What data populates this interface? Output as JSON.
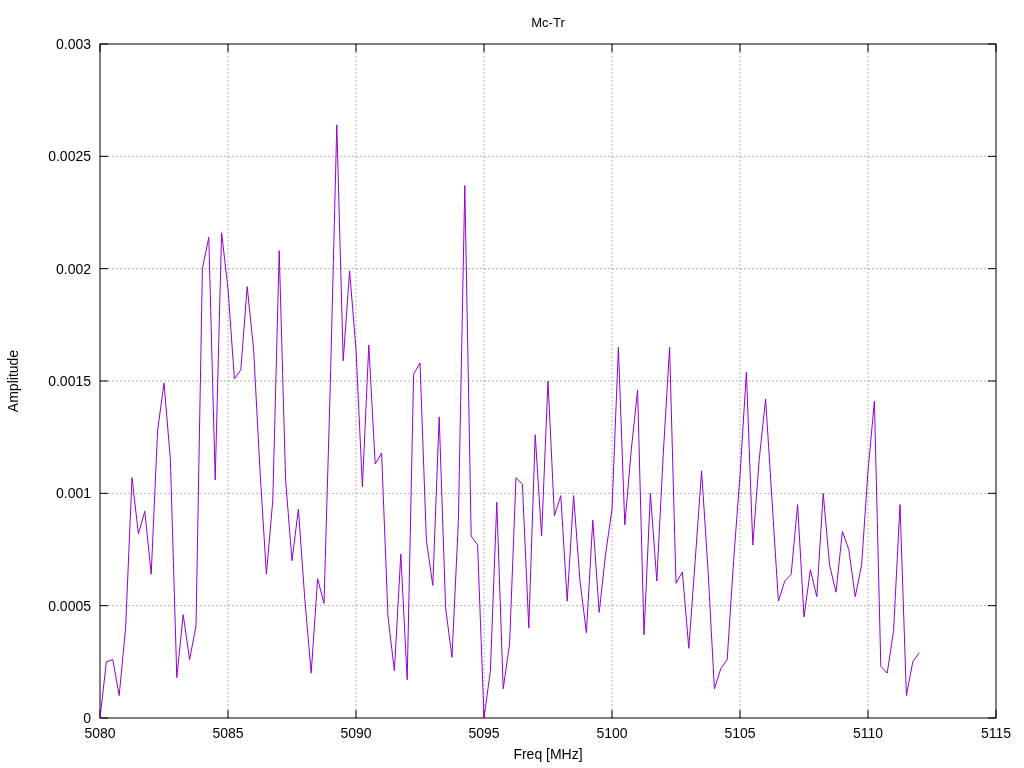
{
  "chart_data": {
    "type": "line",
    "title": "Mc-Tr",
    "xlabel": "Freq [MHz]",
    "ylabel": "Amplitude",
    "xlim": [
      5080,
      5115
    ],
    "grid": true,
    "ylim": [
      0,
      0.003
    ],
    "xticks": [
      5080,
      5085,
      5090,
      5095,
      5100,
      5105,
      5110,
      5115
    ],
    "yticks": [
      0,
      0.0005,
      0.001,
      0.0015,
      0.002,
      0.0025,
      0.003
    ],
    "x": [
      5080,
      5080.25,
      5080.5,
      5080.75,
      5081,
      5081.25,
      5081.5,
      5081.75,
      5082,
      5082.25,
      5082.5,
      5082.75,
      5083,
      5083.25,
      5083.5,
      5083.75,
      5084,
      5084.25,
      5084.5,
      5084.75,
      5085,
      5085.25,
      5085.5,
      5085.75,
      5086,
      5086.25,
      5086.5,
      5086.75,
      5087,
      5087.25,
      5087.5,
      5087.75,
      5088,
      5088.25,
      5088.5,
      5088.75,
      5089,
      5089.25,
      5089.5,
      5089.75,
      5090,
      5090.25,
      5090.5,
      5090.75,
      5091,
      5091.25,
      5091.5,
      5091.75,
      5092,
      5092.25,
      5092.5,
      5092.75,
      5093,
      5093.25,
      5093.5,
      5093.75,
      5094,
      5094.25,
      5094.5,
      5094.75,
      5095,
      5095.25,
      5095.5,
      5095.75,
      5096,
      5096.25,
      5096.5,
      5096.75,
      5097,
      5097.25,
      5097.5,
      5097.75,
      5098,
      5098.25,
      5098.5,
      5098.75,
      5099,
      5099.25,
      5099.5,
      5099.75,
      5100,
      5100.25,
      5100.5,
      5100.75,
      5101,
      5101.25,
      5101.5,
      5101.75,
      5102,
      5102.25,
      5102.5,
      5102.75,
      5103,
      5103.25,
      5103.5,
      5103.75,
      5104,
      5104.25,
      5104.5,
      5104.75,
      5105,
      5105.25,
      5105.5,
      5105.75,
      5106,
      5106.25,
      5106.5,
      5106.75,
      5107,
      5107.25,
      5107.5,
      5107.75,
      5108,
      5108.25,
      5108.5,
      5108.75,
      5109,
      5109.25,
      5109.5,
      5109.75,
      5110,
      5110.25,
      5110.5,
      5110.75,
      5111,
      5111.25,
      5111.5,
      5111.75,
      5112
    ],
    "series": [
      {
        "color": "#9400d3",
        "values": [
          0,
          0.00025,
          0.00026,
          0.0001,
          0.0004,
          0.00107,
          0.00082,
          0.00092,
          0.00064,
          0.00128,
          0.00149,
          0.00115,
          0.00018,
          0.00046,
          0.00026,
          0.00041,
          0.002,
          0.00214,
          0.00106,
          0.00216,
          0.00191,
          0.00151,
          0.00155,
          0.00192,
          0.00164,
          0.0011,
          0.00064,
          0.00097,
          0.00208,
          0.00106,
          0.0007,
          0.00093,
          0.00053,
          0.0002,
          0.00062,
          0.00051,
          0.0015,
          0.00264,
          0.00159,
          0.00199,
          0.00164,
          0.00103,
          0.00166,
          0.00113,
          0.00118,
          0.00045,
          0.00021,
          0.00073,
          0.00017,
          0.00153,
          0.00158,
          0.00079,
          0.00059,
          0.00134,
          0.00049,
          0.00027,
          0.00088,
          0.00237,
          0.00081,
          0.00077,
          0,
          0.00021,
          0.00096,
          0.00013,
          0.00033,
          0.00107,
          0.00104,
          0.0004,
          0.00126,
          0.00081,
          0.0015,
          0.0009,
          0.00099,
          0.00052,
          0.00099,
          0.00061,
          0.00038,
          0.00088,
          0.00047,
          0.00073,
          0.00093,
          0.00165,
          0.00086,
          0.00119,
          0.00146,
          0.00037,
          0.001,
          0.00061,
          0.00117,
          0.00165,
          0.0006,
          0.00065,
          0.00031,
          0.0007,
          0.0011,
          0.00066,
          0.00013,
          0.00022,
          0.00026,
          0.0007,
          0.00108,
          0.00154,
          0.00077,
          0.00115,
          0.00142,
          0.00097,
          0.00052,
          0.00061,
          0.00064,
          0.00095,
          0.00045,
          0.00066,
          0.00054,
          0.001,
          0.00068,
          0.00056,
          0.00083,
          0.00075,
          0.00054,
          0.00068,
          0.0011,
          0.00141,
          0.00023,
          0.0002,
          0.00039,
          0.00095,
          0.0001,
          0.00025,
          0.00029
        ]
      }
    ]
  }
}
